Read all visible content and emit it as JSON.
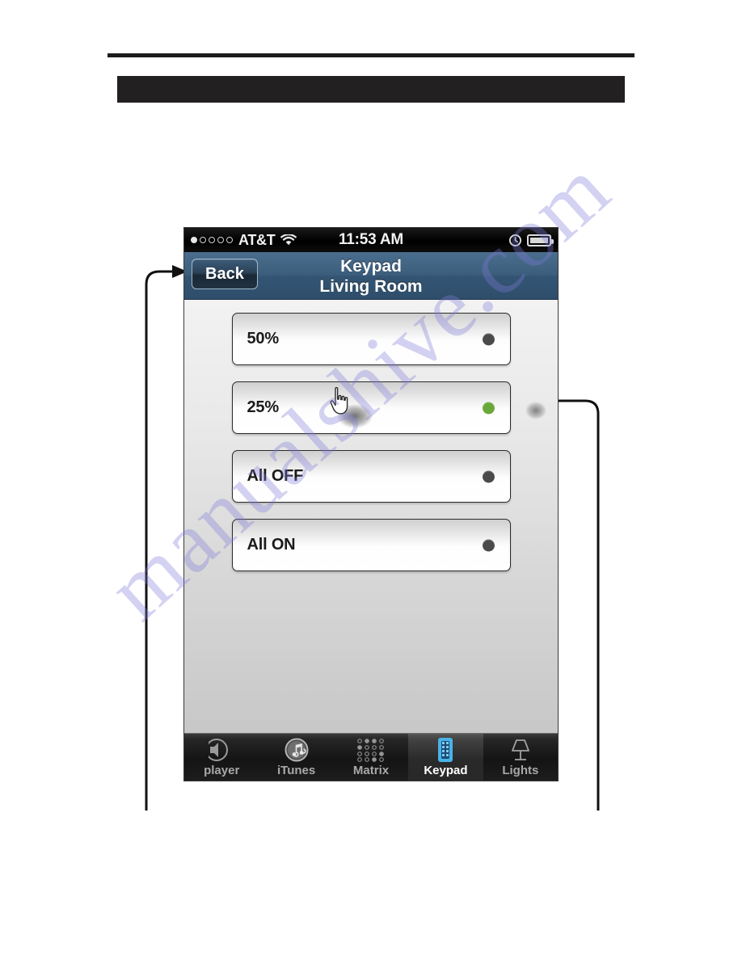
{
  "page": {
    "header_bar_note": "",
    "watermark_text": "manualshive.com"
  },
  "device": {
    "status_bar": {
      "signal_icon": "signal-dots-icon",
      "carrier": "AT&T",
      "wifi_icon": "wifi-icon",
      "time": "11:53 AM",
      "alarm_icon": "clock-icon",
      "battery_icon": "battery-full-icon"
    },
    "nav_bar": {
      "back_label": "Back",
      "title_line1": "Keypad",
      "title_line2": "Living Room",
      "bg_color": "#3c5e7c"
    },
    "list": {
      "rows": [
        {
          "label": "50%",
          "indicator": "off",
          "indicator_color": "#4a4a4a"
        },
        {
          "label": "25%",
          "indicator": "on",
          "indicator_color": "#6aa83a"
        },
        {
          "label": "All OFF",
          "indicator": "off",
          "indicator_color": "#4a4a4a"
        },
        {
          "label": "All ON",
          "indicator": "off",
          "indicator_color": "#4a4a4a"
        }
      ]
    },
    "tab_bar": {
      "tabs": [
        {
          "label": "player",
          "icon": "media-player-icon",
          "selected": false
        },
        {
          "label": "iTunes",
          "icon": "itunes-note-icon",
          "selected": false
        },
        {
          "label": "Matrix",
          "icon": "matrix-grid-icon",
          "selected": false
        },
        {
          "label": "Keypad",
          "icon": "keypad-icon",
          "selected": true
        },
        {
          "label": "Lights",
          "icon": "lamp-icon",
          "selected": false
        }
      ]
    },
    "cursor": {
      "icon": "pointing-hand-cursor"
    }
  },
  "callouts": [
    {
      "name": "back-button-callout",
      "target": "Back button",
      "direction": "right"
    },
    {
      "name": "status-indicator-callout",
      "target": "Active indicator light",
      "direction": "left"
    }
  ]
}
